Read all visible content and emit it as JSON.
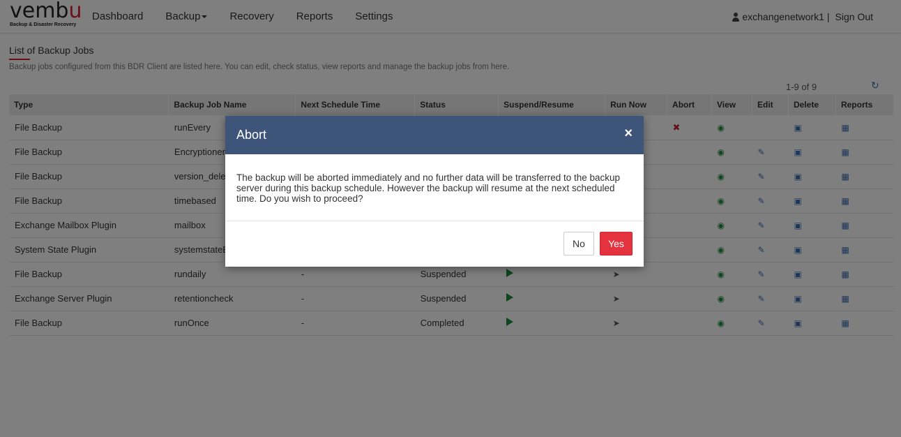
{
  "header": {
    "logo_text_main": "vemb",
    "logo_text_accent": "u",
    "logo_subtitle": "Backup & Disaster Recovery",
    "nav": [
      {
        "label": "Dashboard"
      },
      {
        "label": "Backup"
      },
      {
        "label": "Recovery"
      },
      {
        "label": "Reports"
      },
      {
        "label": "Settings"
      }
    ],
    "username": "exchangenetwork1",
    "separator": "|",
    "signout": "Sign Out"
  },
  "page": {
    "title": "List of Backup Jobs",
    "description": "Backup jobs configured from this BDR Client are listed here. You can edit, check status, view reports and manage the backup jobs from here.",
    "pagination": "1-9 of 9"
  },
  "table": {
    "columns": [
      "Type",
      "Backup Job Name",
      "Next Schedule Time",
      "Status",
      "Suspend/Resume",
      "Run Now",
      "Abort",
      "View",
      "Edit",
      "Delete",
      "Reports"
    ],
    "rows": [
      {
        "type": "File Backup",
        "name": "runEvery",
        "next": "",
        "status": "",
        "abort": true,
        "edit": false,
        "play": false,
        "run": false
      },
      {
        "type": "File Backup",
        "name": "Encryptioner",
        "next": "",
        "status": "",
        "abort": false,
        "edit": true,
        "play": false,
        "run": false
      },
      {
        "type": "File Backup",
        "name": "version_delet",
        "next": "",
        "status": "",
        "abort": false,
        "edit": true,
        "play": false,
        "run": false
      },
      {
        "type": "File Backup",
        "name": "timebased",
        "next": "",
        "status": "",
        "abort": false,
        "edit": true,
        "play": false,
        "run": false
      },
      {
        "type": "Exchange Mailbox Plugin",
        "name": "mailbox",
        "next": "",
        "status": "",
        "abort": false,
        "edit": true,
        "play": false,
        "run": false
      },
      {
        "type": "System State Plugin",
        "name": "systemstateE",
        "next": "",
        "status": "",
        "abort": false,
        "edit": true,
        "play": false,
        "run": false
      },
      {
        "type": "File Backup",
        "name": "rundaily",
        "next": "-",
        "status": "Suspended",
        "abort": false,
        "edit": true,
        "play": true,
        "run": true
      },
      {
        "type": "Exchange Server Plugin",
        "name": "retentioncheck",
        "next": "-",
        "status": "Suspended",
        "abort": false,
        "edit": true,
        "play": true,
        "run": true
      },
      {
        "type": "File Backup",
        "name": "runOnce",
        "next": "-",
        "status": "Completed",
        "abort": false,
        "edit": true,
        "play": true,
        "run": true
      }
    ]
  },
  "modal": {
    "title": "Abort",
    "close": "×",
    "message": "The backup will be aborted immediately and no further data will be transferred to the backup server during this backup schedule. However the backup will resume at the next scheduled time. Do you wish to proceed?",
    "no_label": "No",
    "yes_label": "Yes"
  },
  "colors": {
    "modal_header": "#3e5479",
    "accent_red": "#e5323f",
    "brand_red": "#d81e2c",
    "view_green": "#1f8a3e",
    "icon_blue": "#3a6fb5"
  },
  "icons": {
    "abort": "times-icon",
    "view": "eye-icon",
    "edit": "edit-icon",
    "delete": "trash-icon",
    "reports": "calendar-icon",
    "suspend_resume": "play-icon",
    "run_now": "rocket-icon",
    "refresh": "refresh-icon",
    "user": "user-icon"
  }
}
